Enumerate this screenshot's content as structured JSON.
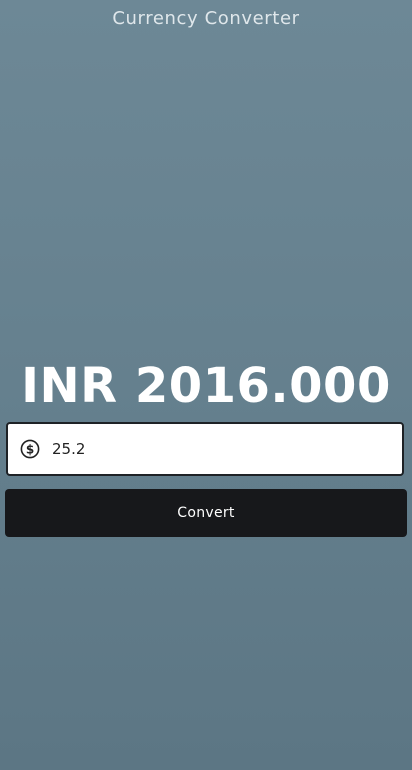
{
  "app": {
    "title": "Currency Converter"
  },
  "result": {
    "text": "INR 2016.000"
  },
  "amount_input": {
    "value": "25.2",
    "icon": "dollar-icon"
  },
  "convert_button": {
    "label": "Convert"
  }
}
